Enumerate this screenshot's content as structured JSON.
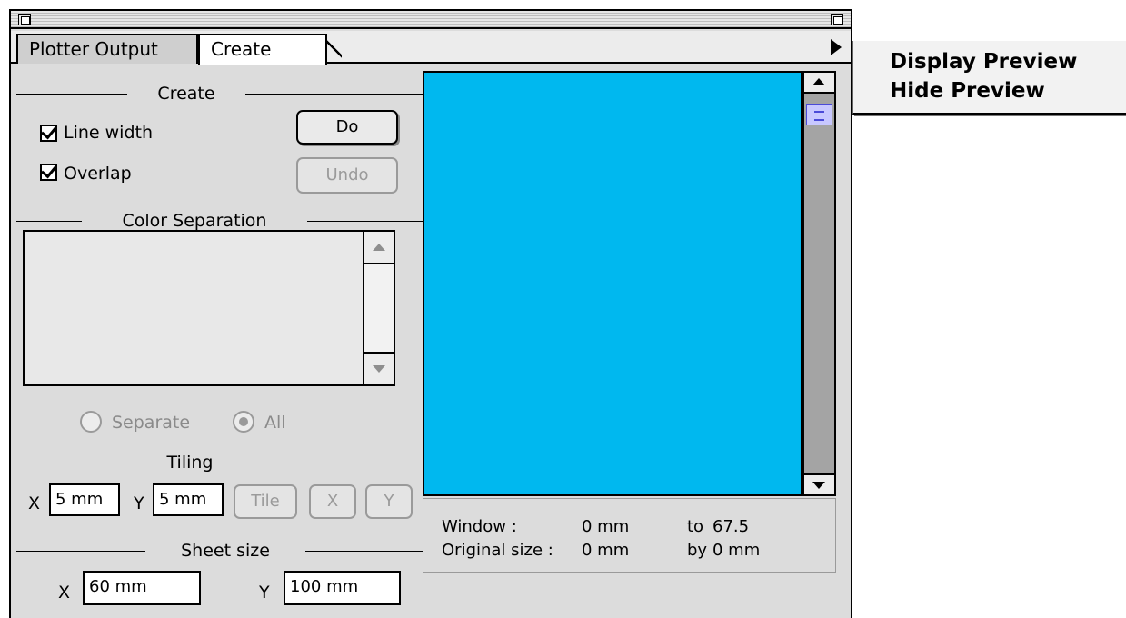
{
  "tabs": {
    "plotter_output": "Plotter Output",
    "create": "Create"
  },
  "create_section": {
    "header": "Create",
    "line_width_label": "Line width",
    "line_width_checked": true,
    "overlap_label": "Overlap",
    "overlap_checked": true,
    "do_label": "Do",
    "undo_label": "Undo"
  },
  "color_separation": {
    "header": "Color Separation",
    "items": [],
    "separate_label": "Separate",
    "all_label": "All",
    "selected": "All"
  },
  "tiling": {
    "header": "Tiling",
    "x_label": "X",
    "x_value": "5 mm",
    "y_label": "Y",
    "y_value": "5 mm",
    "tile_label": "Tile",
    "x_button": "X",
    "y_button": "Y"
  },
  "sheet_size": {
    "header": "Sheet size",
    "x_label": "X",
    "x_value": "60 mm",
    "y_label": "Y",
    "y_value": "100 mm"
  },
  "preview": {
    "fill_color": "#00b8ef",
    "window_label": "Window :",
    "window_value": "0 mm",
    "window_to_label": "to",
    "window_to_value": "67.5",
    "original_label": "Original size :",
    "original_value": "0 mm",
    "original_by_label": "by",
    "original_by_value": "0 mm"
  },
  "popup_menu": {
    "items": [
      "Display Preview",
      "Hide Preview"
    ]
  }
}
